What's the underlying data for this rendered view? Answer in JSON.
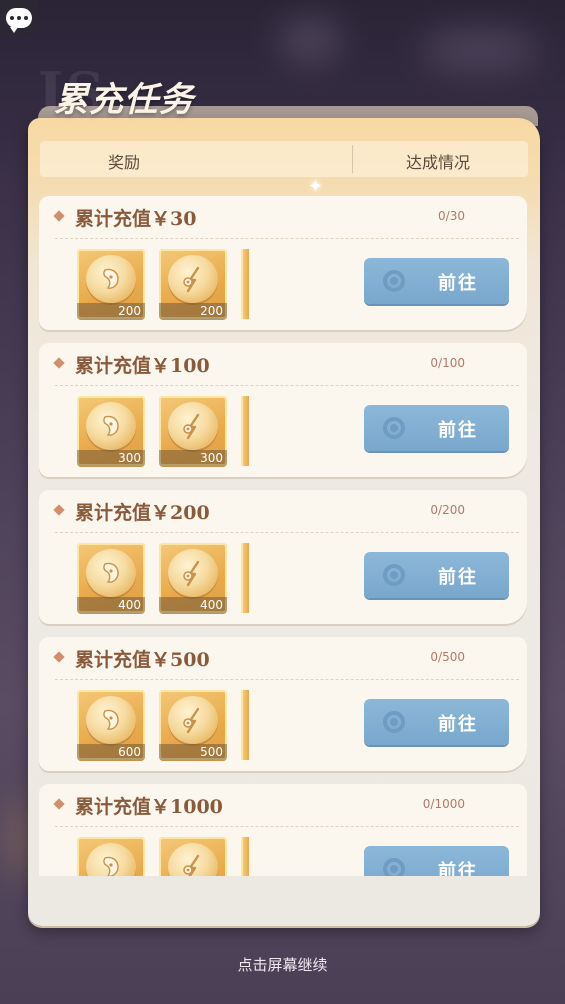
{
  "panel": {
    "title": "累充任务",
    "title_ghost": "IS"
  },
  "header": {
    "reward_label": "奖励",
    "status_label": "达成情况"
  },
  "tasks": [
    {
      "title": "累计充值￥30",
      "progress": "0/30",
      "rewards": [
        {
          "icon": "mask-coin-icon",
          "qty": "200"
        },
        {
          "icon": "fish-coin-icon",
          "qty": "200"
        }
      ],
      "button": "前往"
    },
    {
      "title": "累计充值￥100",
      "progress": "0/100",
      "rewards": [
        {
          "icon": "mask-coin-icon",
          "qty": "300"
        },
        {
          "icon": "fish-coin-icon",
          "qty": "300"
        }
      ],
      "button": "前往"
    },
    {
      "title": "累计充值￥200",
      "progress": "0/200",
      "rewards": [
        {
          "icon": "mask-coin-icon",
          "qty": "400"
        },
        {
          "icon": "fish-coin-icon",
          "qty": "400"
        }
      ],
      "button": "前往"
    },
    {
      "title": "累计充值￥500",
      "progress": "0/500",
      "rewards": [
        {
          "icon": "mask-coin-icon",
          "qty": "600"
        },
        {
          "icon": "fish-coin-icon",
          "qty": "500"
        }
      ],
      "button": "前往"
    },
    {
      "title": "累计充值￥1000",
      "progress": "0/1000",
      "rewards": [
        {
          "icon": "mask-coin-icon",
          "qty": ""
        },
        {
          "icon": "fish-coin-icon",
          "qty": ""
        }
      ],
      "button": "前往"
    }
  ],
  "footer": {
    "continue_text": "点击屏幕继续"
  },
  "colors": {
    "accent_button": "#79a7cd",
    "title_text": "#8a5a3c",
    "progress_text": "#b5786a"
  }
}
